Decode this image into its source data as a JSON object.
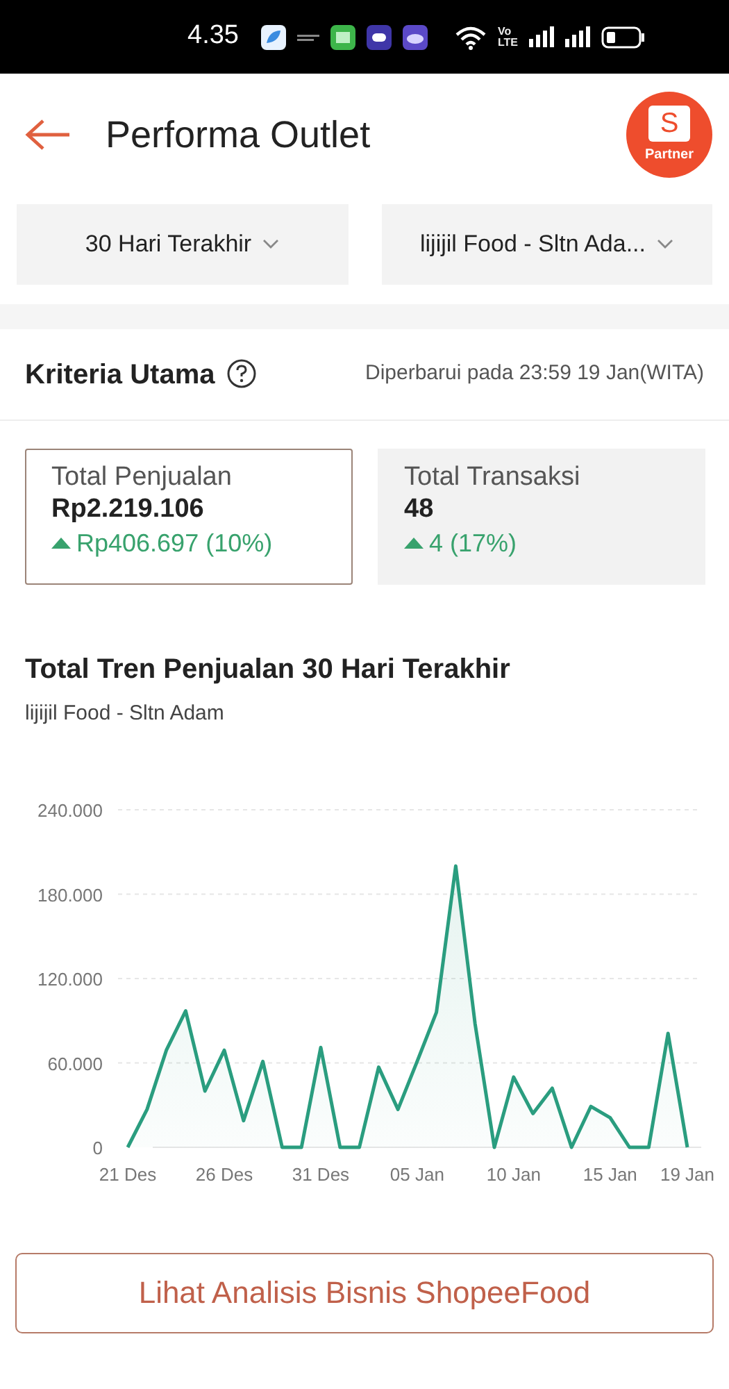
{
  "status_bar": {
    "time": "4.35",
    "volte": [
      "Vo",
      "LTE"
    ]
  },
  "header": {
    "title": "Performa Outlet",
    "logo": {
      "letter": "S",
      "caption": "Partner"
    }
  },
  "filters": [
    {
      "label": "30 Hari Terakhir"
    },
    {
      "label": "lijijil Food - Sltn Ada..."
    }
  ],
  "section": {
    "title": "Kriteria Utama",
    "updated": "Diperbarui pada 23:59 19 Jan(WITA)"
  },
  "metrics": [
    {
      "label": "Total Penjualan",
      "value": "Rp2.219.106",
      "change": "Rp406.697",
      "percent": "(10%)",
      "selected": true
    },
    {
      "label": "Total Transaksi",
      "value": "48",
      "change": "4",
      "percent": "(17%)",
      "selected": false
    }
  ],
  "trend": {
    "title": "Total Tren Penjualan 30 Hari Terakhir",
    "subtitle": "lijijil Food - Sltn Adam",
    "chart_data": {
      "type": "area",
      "categories": [
        "21 Des",
        null,
        null,
        null,
        null,
        "26 Des",
        null,
        null,
        null,
        null,
        "31 Des",
        null,
        null,
        null,
        null,
        "05 Jan",
        null,
        null,
        null,
        null,
        "10 Jan",
        null,
        null,
        null,
        null,
        "15 Jan",
        null,
        null,
        null,
        "19 Jan"
      ],
      "series": [
        {
          "color": "#2a9d7f",
          "values": [
            0,
            27,
            69,
            97,
            40,
            69,
            19,
            61,
            0,
            0,
            71,
            0,
            0,
            57,
            27,
            61,
            96,
            200,
            88,
            0,
            50,
            24,
            42,
            0,
            29,
            21,
            0,
            0,
            81,
            0
          ]
        }
      ],
      "ylim": [
        0,
        240
      ],
      "grid": true,
      "yticks": [
        {
          "value": 0,
          "label": "0"
        },
        {
          "value": 60,
          "label": "60.000"
        },
        {
          "value": 120,
          "label": "120.000"
        },
        {
          "value": 180,
          "label": "180.000"
        },
        {
          "value": 240,
          "label": "240.000"
        }
      ]
    }
  },
  "action_button": {
    "label": "Lihat Analisis Bisnis ShopeeFood"
  }
}
